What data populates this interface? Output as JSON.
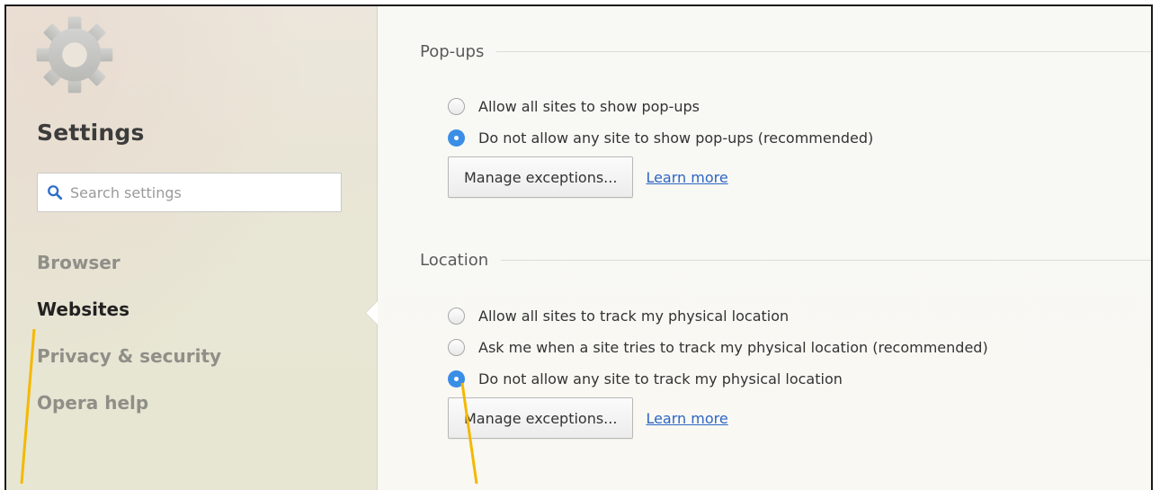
{
  "sidebar": {
    "title": "Settings",
    "search": {
      "placeholder": "Search settings",
      "value": ""
    },
    "items": [
      {
        "label": "Browser",
        "active": false
      },
      {
        "label": "Websites",
        "active": true
      },
      {
        "label": "Privacy & security",
        "active": false
      },
      {
        "label": "Opera help",
        "active": false
      }
    ]
  },
  "sections": {
    "popups": {
      "title": "Pop-ups",
      "options": [
        {
          "label": "Allow all sites to show pop-ups",
          "checked": false
        },
        {
          "label": "Do not allow any site to show pop-ups (recommended)",
          "checked": true
        }
      ],
      "manage_label": "Manage exceptions...",
      "learn_more": "Learn more"
    },
    "location": {
      "title": "Location",
      "options": [
        {
          "label": "Allow all sites to track my physical location",
          "checked": false
        },
        {
          "label": "Ask me when a site tries to track my physical location (recommended)",
          "checked": false
        },
        {
          "label": "Do not allow any site to track my physical location",
          "checked": true
        }
      ],
      "manage_label": "Manage exceptions...",
      "learn_more": "Learn more"
    }
  },
  "colors": {
    "accent": "#3a8ee6",
    "link": "#2d66c4",
    "callout": "#f5b800"
  },
  "icons": {
    "gear": "gear-icon",
    "search": "search-icon"
  }
}
